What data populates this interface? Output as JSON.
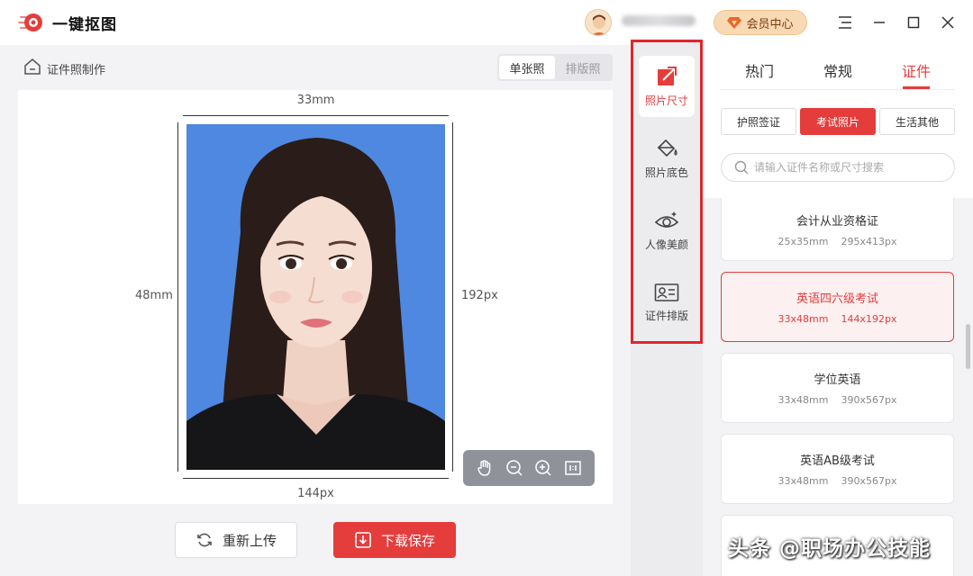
{
  "app": {
    "name": "一键抠图"
  },
  "header": {
    "vip_label": "会员中心"
  },
  "main": {
    "section_title": "证件照制作",
    "mode_options": [
      "单张照",
      "排版照"
    ],
    "dims": {
      "width_mm": "33mm",
      "height_mm": "48mm",
      "height_px": "192px",
      "width_px": "144px"
    },
    "reupload_label": "重新上传",
    "download_label": "下载保存"
  },
  "midnav": {
    "items": [
      {
        "label": "照片尺寸",
        "icon": "photo-size-icon"
      },
      {
        "label": "照片底色",
        "icon": "paint-bucket-icon"
      },
      {
        "label": "人像美颜",
        "icon": "eye-beauty-icon"
      },
      {
        "label": "证件排版",
        "icon": "id-card-icon"
      }
    ]
  },
  "right": {
    "tabs": [
      "热门",
      "常规",
      "证件"
    ],
    "categories": [
      "护照签证",
      "考试照片",
      "生活其他"
    ],
    "search_placeholder": "请输入证件名称或尺寸搜索",
    "list": [
      {
        "name": "会计从业资格证",
        "mm": "25x35mm",
        "px": "295x413px"
      },
      {
        "name": "英语四六级考试",
        "mm": "33x48mm",
        "px": "144x192px"
      },
      {
        "name": "学位英语",
        "mm": "33x48mm",
        "px": "390x567px"
      },
      {
        "name": "英语AB级考试",
        "mm": "33x48mm",
        "px": "390x567px"
      }
    ]
  },
  "colors": {
    "accent": "#e53c3c",
    "photo_bg": "#4f88e0",
    "nav_frame": "#e0262c"
  },
  "watermark": "头条 @职场办公技能"
}
